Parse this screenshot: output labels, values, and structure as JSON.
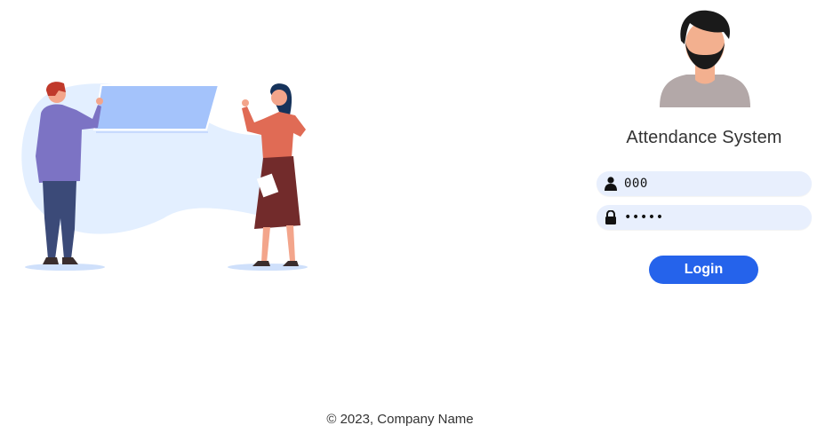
{
  "login": {
    "title": "Attendance System",
    "username_value": "000",
    "password_value": "00000",
    "login_label": "Login"
  },
  "footer": {
    "text": "© 2023, Company Name"
  },
  "colors": {
    "accent": "#2563eb",
    "field_bg": "#e8effd",
    "illustration_blob": "#e3efff",
    "screen": "#a4c3fb"
  },
  "icons": {
    "user": "person-icon",
    "password": "lock-icon"
  }
}
